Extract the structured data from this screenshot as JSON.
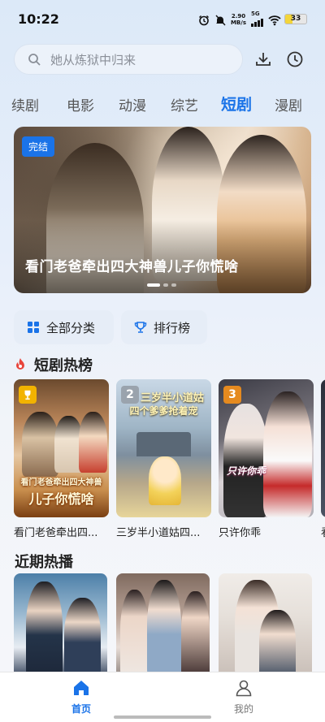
{
  "status_bar": {
    "time": "10:22",
    "net_speed_value": "2.90",
    "net_speed_unit": "MB/s",
    "network": "5G",
    "battery": "33"
  },
  "search": {
    "placeholder": "她从炼狱中归来"
  },
  "header_icons": [
    "download-icon",
    "history-icon"
  ],
  "tabs": [
    {
      "label": "续剧",
      "active": false
    },
    {
      "label": "电影",
      "active": false
    },
    {
      "label": "动漫",
      "active": false
    },
    {
      "label": "综艺",
      "active": false
    },
    {
      "label": "短剧",
      "active": true
    },
    {
      "label": "漫剧",
      "active": false
    }
  ],
  "banner": {
    "badge": "完结",
    "title": "看门老爸牵出四大神兽儿子你慌啥",
    "page_count": 3,
    "current_page": 1
  },
  "quick_buttons": [
    {
      "label": "全部分类",
      "icon": "grid-icon"
    },
    {
      "label": "排行榜",
      "icon": "trophy-icon"
    }
  ],
  "hot_section": {
    "title": "短剧热榜",
    "items": [
      {
        "rank": "1",
        "title": "看门老爸牵出四...",
        "poster_text_1": "看门老爸牵出四大神兽",
        "poster_text_2": "儿子你慌啥",
        "rank_color": "#f2b300"
      },
      {
        "rank": "2",
        "title": "三岁半小道姑四...",
        "poster_text_1": "三岁半小道姑",
        "poster_text_2": "四个爹爹抢着宠",
        "rank_color": "#9aa3ad"
      },
      {
        "rank": "3",
        "title": "只许你乖",
        "poster_text_1": "只许你乖",
        "rank_color": "#e58a1f"
      },
      {
        "rank": "",
        "title": "看"
      }
    ]
  },
  "recent_section": {
    "title": "近期热播"
  },
  "bottom_nav": [
    {
      "label": "首页",
      "icon": "home-icon",
      "active": true
    },
    {
      "label": "我的",
      "icon": "user-icon",
      "active": false
    }
  ],
  "colors": {
    "accent": "#1a73e8"
  }
}
